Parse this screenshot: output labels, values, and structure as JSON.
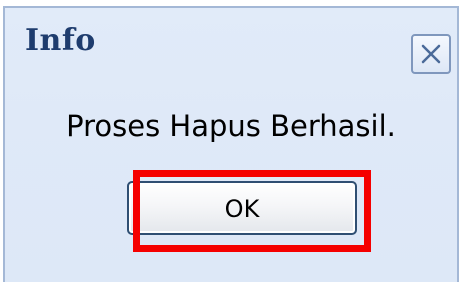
{
  "dialog": {
    "title": "Info",
    "message": "Proses Hapus Berhasil.",
    "close_icon": "close-icon",
    "buttons": {
      "ok_label": "OK"
    }
  },
  "colors": {
    "title_text": "#1e3c6e",
    "dialog_background": "#dfe9f8",
    "dialog_border": "#a4b8d6",
    "highlight": "#f50000"
  }
}
